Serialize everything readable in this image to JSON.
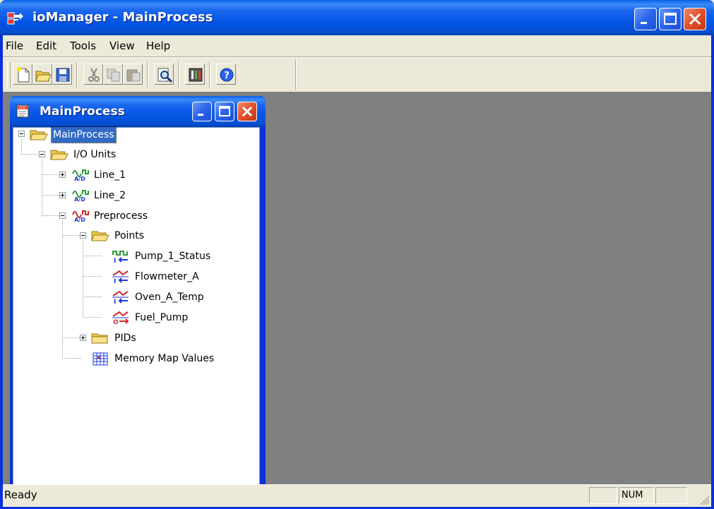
{
  "window": {
    "title": "ioManager - MainProcess",
    "app_icon": "iomanager-app-icon"
  },
  "menu": [
    "File",
    "Edit",
    "Tools",
    "View",
    "Help"
  ],
  "toolbar": {
    "buttons": [
      "new-icon",
      "open-icon",
      "save-icon",
      "cut-icon",
      "copy-icon",
      "paste-icon",
      "inspect-icon",
      "configure-icon",
      "help-icon"
    ]
  },
  "child_window": {
    "title": "MainProcess"
  },
  "tree": {
    "root": "MainProcess",
    "io_units": "I/O Units",
    "line1": "Line_1",
    "line2": "Line_2",
    "preprocess": "Preprocess",
    "points": "Points",
    "p1": "Pump_1_Status",
    "p2": "Flowmeter_A",
    "p3": "Oven_A_Temp",
    "p4": "Fuel_Pump",
    "pids": "PIDs",
    "memmap": "Memory Map Values"
  },
  "status": {
    "text": "Ready",
    "num": "NUM"
  },
  "colors": {
    "titlebar": "#0054e3",
    "selection": "#316ac5",
    "mdi_background": "#808080",
    "face": "#ece9d8"
  }
}
